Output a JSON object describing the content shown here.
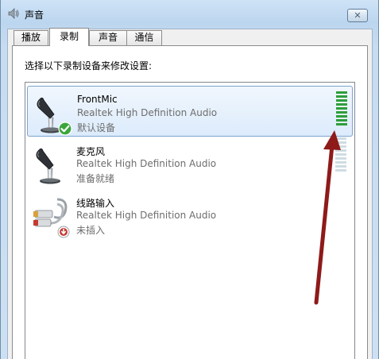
{
  "window": {
    "title": "声音",
    "close_glyph": "✕",
    "title_icon": "speaker-icon"
  },
  "tabs": [
    {
      "label": "播放",
      "active": false
    },
    {
      "label": "录制",
      "active": true
    },
    {
      "label": "声音",
      "active": false
    },
    {
      "label": "通信",
      "active": false
    }
  ],
  "panel": {
    "instruction": "选择以下录制设备来修改设置:"
  },
  "devices": [
    {
      "name": "FrontMic",
      "description": "Realtek High Definition Audio",
      "status": "默认设备",
      "icon": "microphone-icon",
      "badge": "default-check-badge-icon",
      "selected": true,
      "level": 1.0
    },
    {
      "name": "麦克风",
      "description": "Realtek High Definition Audio",
      "status": "准备就绪",
      "icon": "microphone-icon",
      "badge": null,
      "selected": false,
      "level": 0.0
    },
    {
      "name": "线路输入",
      "description": "Realtek High Definition Audio",
      "status": "未插入",
      "icon": "rca-cable-icon",
      "badge": "unplugged-badge-icon",
      "selected": false,
      "level": null
    }
  ],
  "colors": {
    "meter_active": "#2e9e3b",
    "meter_inactive": "#cfdde3",
    "annotation_arrow": "#8e1a1a",
    "selection_border": "#7da2ce"
  }
}
